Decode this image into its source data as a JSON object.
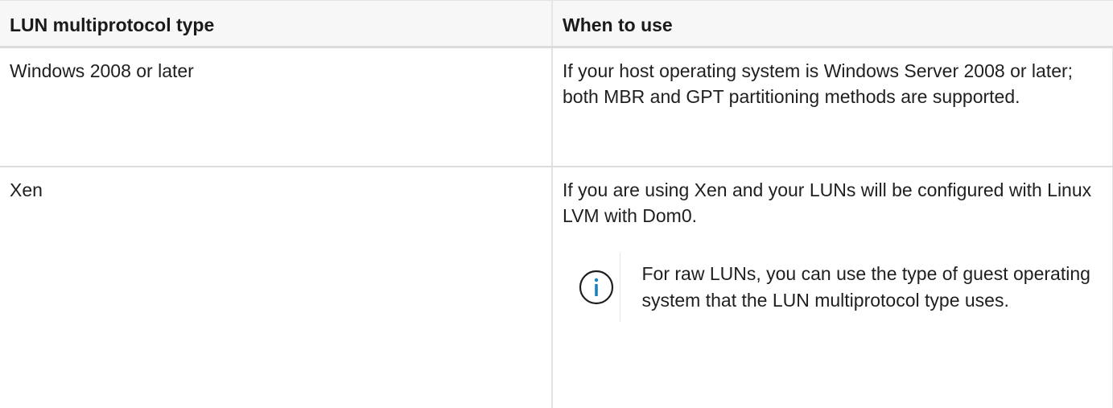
{
  "table": {
    "headers": {
      "type": "LUN multiprotocol type",
      "when": "When to use"
    },
    "rows": [
      {
        "type": "Windows 2008 or later",
        "when": "If your host operating system is Windows Server 2008 or later; both MBR and GPT partitioning methods are supported."
      },
      {
        "type": "Xen",
        "when": "If you are using Xen and your LUNs will be configured with Linux LVM with Dom0.",
        "note": {
          "icon": "info-icon",
          "text": "For raw LUNs, you can use the type of guest operating system that the LUN multiprotocol type uses."
        }
      }
    ]
  },
  "colors": {
    "header_bg": "#f7f7f7",
    "border": "#dcdcdc",
    "info_icon": "#1a80c4"
  }
}
